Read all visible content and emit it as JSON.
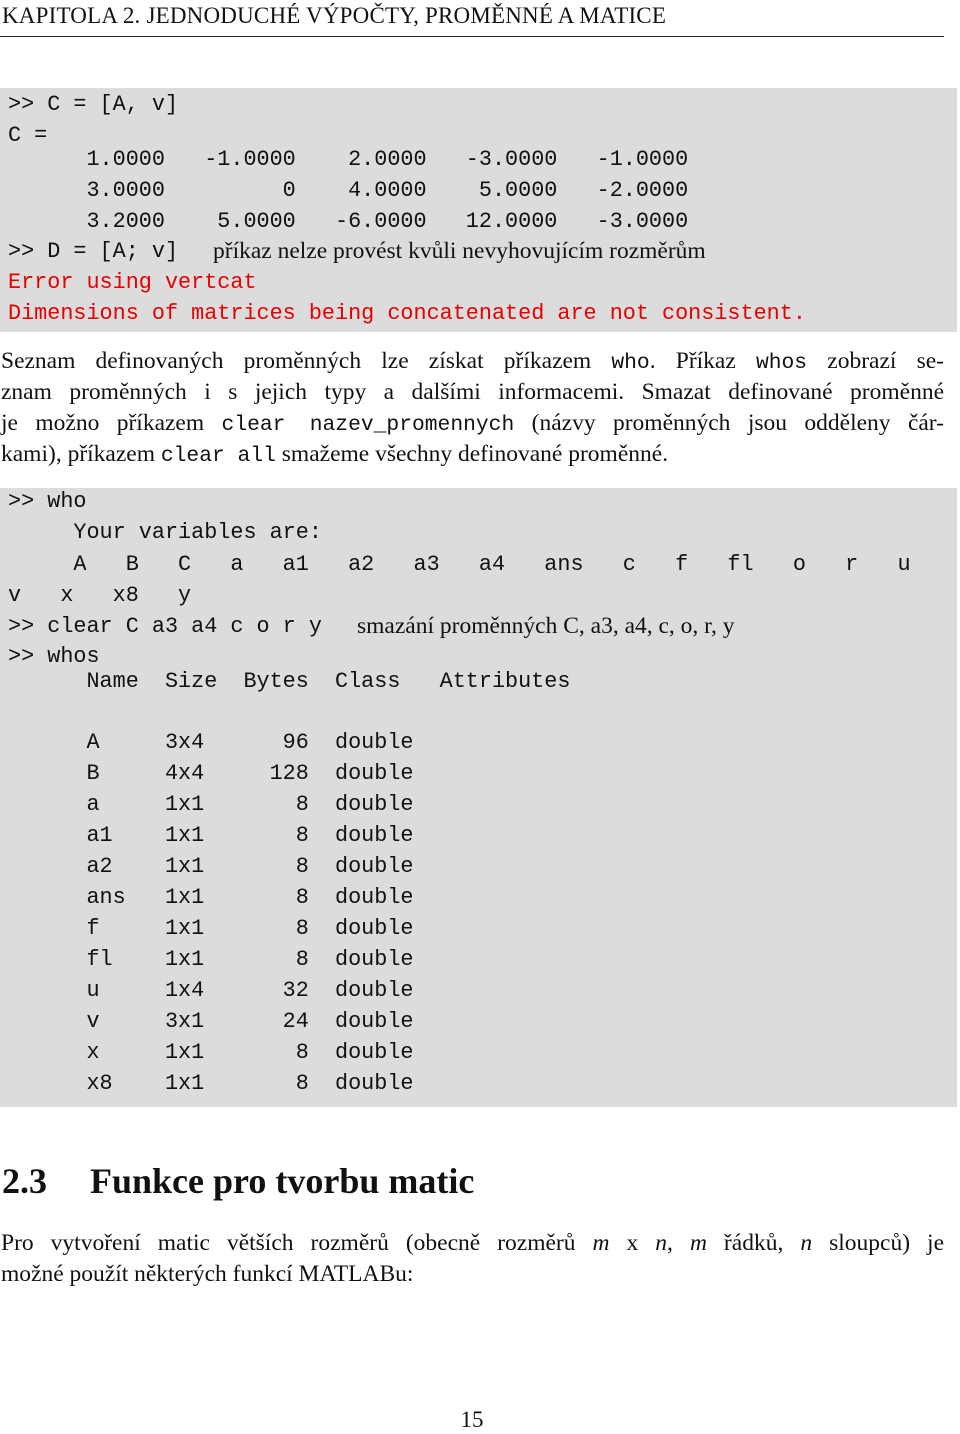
{
  "header": {
    "title": "KAPITOLA 2.  JEDNODUCHÉ VÝPOČTY, PROMĚNNÉ A MATICE"
  },
  "code1": {
    "lines": [
      ">> C = [A, v]",
      "C =",
      "      1.0000   -1.0000    2.0000   -3.0000   -1.0000",
      "      3.0000         0    4.0000    5.0000   -2.0000",
      "      3.2000    5.0000   -6.0000   12.0000   -3.0000",
      ">> D = [A; v]"
    ],
    "comment": "příkaz nelze provést kvůli nevyhovujícím rozměrům",
    "errors": [
      "Error using vertcat",
      "Dimensions of matrices being concatenated are not consistent."
    ],
    "error_color": "#e60000"
  },
  "para1": {
    "l1": [
      "Seznam definovaných proměnných lze získat příkazem ",
      "who",
      ". Příkaz ",
      "whos",
      " zobrazí se-"
    ],
    "l2": "znam proměnných i s jejich typy a dalšími informacemi. Smazat definované proměnné",
    "l3": [
      "je možno příkazem ",
      "clear nazev_promennych",
      " (názvy proměnných jsou odděleny čár-"
    ],
    "l4": [
      "kami), příkazem ",
      "clear all",
      " smažeme všechny definované proměnné."
    ]
  },
  "code2": {
    "lines": [
      ">> who",
      "     Your variables are:",
      "     A   B   C   a   a1   a2   a3   a4   ans   c   f   fl   o   r   u",
      "v   x   x8   y",
      ">> clear C a3 a4 c o r y",
      ">> whos"
    ],
    "clear_comment": "smazání proměnných C, a3, a4, c, o, r, y",
    "table": {
      "headers": [
        "Name",
        "Size",
        "Bytes",
        "Class",
        "Attributes"
      ],
      "rows": [
        [
          "A",
          "3x4",
          "96",
          "double"
        ],
        [
          "B",
          "4x4",
          "128",
          "double"
        ],
        [
          "a",
          "1x1",
          "8",
          "double"
        ],
        [
          "a1",
          "1x1",
          "8",
          "double"
        ],
        [
          "a2",
          "1x1",
          "8",
          "double"
        ],
        [
          "ans",
          "1x1",
          "8",
          "double"
        ],
        [
          "f",
          "1x1",
          "8",
          "double"
        ],
        [
          "fl",
          "1x1",
          "8",
          "double"
        ],
        [
          "u",
          "1x4",
          "32",
          "double"
        ],
        [
          "v",
          "3x1",
          "24",
          "double"
        ],
        [
          "x",
          "1x1",
          "8",
          "double"
        ],
        [
          "x8",
          "1x1",
          "8",
          "double"
        ]
      ]
    }
  },
  "section": {
    "number": "2.3",
    "title": "Funkce pro tvorbu matic"
  },
  "para2": {
    "l1": [
      "Pro vytvoření matic větších rozměrů (obecně rozměrů ",
      "m",
      " x ",
      "n",
      ", ",
      "m",
      " řádků, ",
      "n",
      " sloupců) je"
    ],
    "l2": "možné použít některých funkcí MATLABu:"
  },
  "page_number": "15"
}
